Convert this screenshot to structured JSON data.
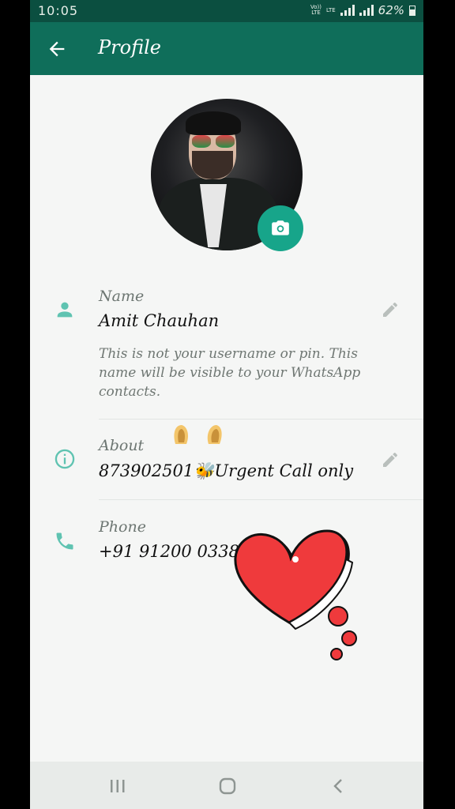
{
  "status_bar": {
    "time": "10:05",
    "carrier_small": "Vo)) LTE",
    "lte_small": "LTE",
    "battery": "62%"
  },
  "app_bar": {
    "title": "Profile",
    "back_icon": "arrow-left-icon"
  },
  "profile": {
    "camera_icon": "camera-icon",
    "name": {
      "label": "Name",
      "value": "Amit Chauhan",
      "hint": "This is not your username or pin. This name will be visible to your WhatsApp contacts.",
      "icon": "person-icon"
    },
    "about": {
      "label": "About",
      "value": "873902501🐝Urgent Call only",
      "icon": "info-icon"
    },
    "phone": {
      "label": "Phone",
      "value": "+91 91200 0338",
      "icon": "phone-icon"
    }
  },
  "colors": {
    "status_bar": "#0b4f40",
    "app_bar": "#0f6e5a",
    "accent": "#17a58a",
    "icon_tint": "#5fc3b1"
  }
}
